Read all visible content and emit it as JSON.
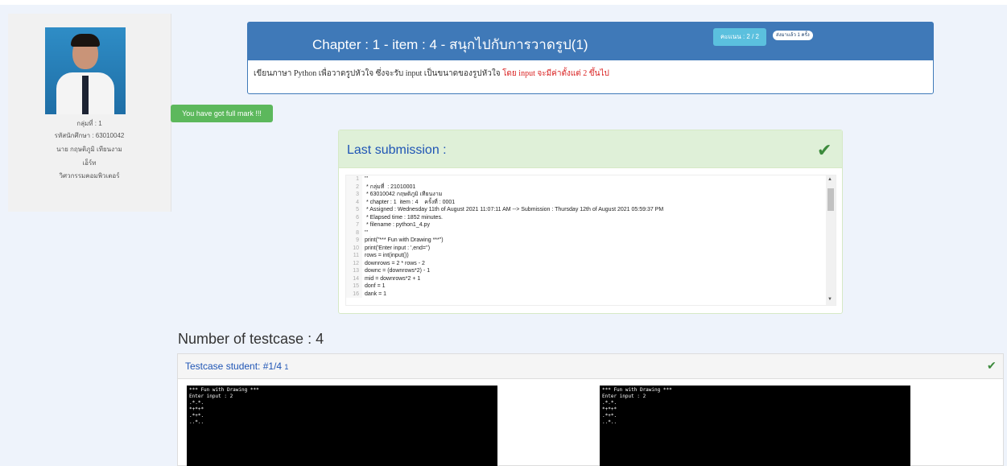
{
  "sidebar": {
    "group": "กลุ่มที่ : 1",
    "student_id": "รหัสนักศึกษา : 63010042",
    "name": "นาย กฤษติภูมิ เทียนงาม",
    "role": "เอ็ร์ท",
    "faculty": "วิศวกรรมคอมพิวเตอร์"
  },
  "full_mark": "You have got full mark !!!",
  "chapter": {
    "title": "Chapter : 1 - item : 4 - สนุกไปกับการวาดรูป(1)",
    "score": "คะแนน : 2 / 2",
    "attempts": "ส่งมาแล้ว 1 ครั้ง",
    "desc_main": "เขียนภาษา Python เพื่อวาดรูปหัวใจ ซึ่งจะรับ input เป็นขนาดของรูปหัวใจ ",
    "desc_red": "โดย input จะมีค่าตั้งแต่ 2 ขึ้นไป"
  },
  "submission": {
    "label": "Last submission :",
    "lines": [
      {
        "n": "1",
        "t": "'''"
      },
      {
        "n": "2",
        "t": " * กลุ่มที่  : 21010001"
      },
      {
        "n": "3",
        "t": " * 63010042 กฤษติภูมิ เทียนงาม"
      },
      {
        "n": "4",
        "t": " * chapter : 1  item : 4    ครั้งที่ : 0001"
      },
      {
        "n": "5",
        "t": " * Assigned : Wednesday 11th of August 2021 11:07:11 AM --> Submission : Thursday 12th of August 2021 05:59:37 PM"
      },
      {
        "n": "6",
        "t": " * Elapsed time : 1852 minutes."
      },
      {
        "n": "7",
        "t": " * filename : python1_4.py"
      },
      {
        "n": "8",
        "t": "'''"
      },
      {
        "n": "9",
        "t": "print(\"*** Fun with Drawing ***\")"
      },
      {
        "n": "10",
        "t": "print('Enter input : ',end='')"
      },
      {
        "n": "11",
        "t": "rows = int(input())"
      },
      {
        "n": "12",
        "t": "downrows = 2 * rows - 2"
      },
      {
        "n": "13",
        "t": "downc = (downrows*2) - 1"
      },
      {
        "n": "14",
        "t": "mid = downrows*2 + 1"
      },
      {
        "n": "15",
        "t": "donf = 1"
      },
      {
        "n": "16",
        "t": "dank = 1"
      }
    ]
  },
  "testcases": {
    "count_label": "Number of testcase : 4",
    "panel_label": "Testcase student: #1/4",
    "panel_small": "1",
    "expected_output": "*** Fun with Drawing ***\nEnter input : 2\n.*.*.\n*+*+*\n.*+*.\n..*..",
    "student_output": "*** Fun with Drawing ***\nEnter input : 2\n.*.*.\n*+*+*\n.*+*.\n..*.."
  }
}
